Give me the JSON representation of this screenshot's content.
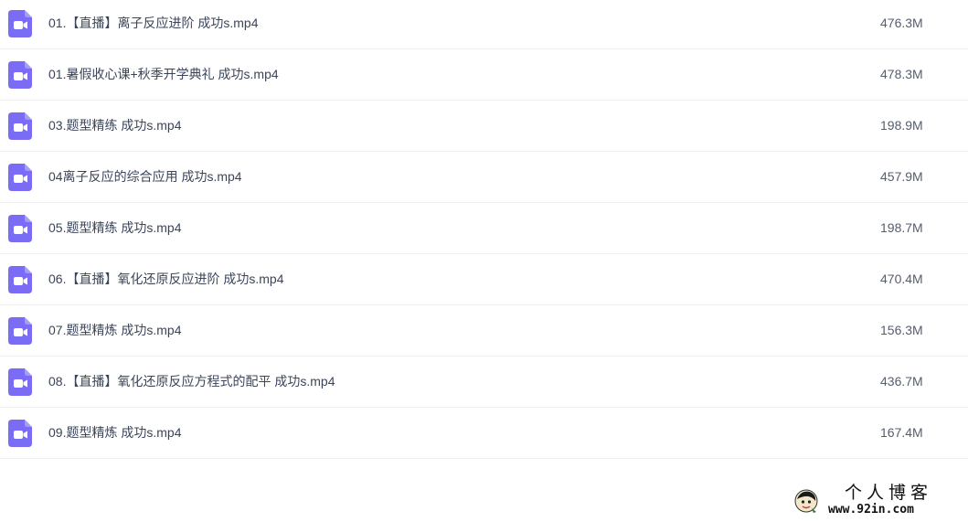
{
  "files": [
    {
      "name": "01.【直播】离子反应进阶 成功s.mp4",
      "size": "476.3M",
      "icon": "video-file-icon"
    },
    {
      "name": "01.暑假收心课+秋季开学典礼 成功s.mp4",
      "size": "478.3M",
      "icon": "video-file-icon"
    },
    {
      "name": "03.题型精练 成功s.mp4",
      "size": "198.9M",
      "icon": "video-file-icon"
    },
    {
      "name": "04离子反应的综合应用 成功s.mp4",
      "size": "457.9M",
      "icon": "video-file-icon"
    },
    {
      "name": "05.题型精练 成功s.mp4",
      "size": "198.7M",
      "icon": "video-file-icon"
    },
    {
      "name": "06.【直播】氧化还原反应进阶 成功s.mp4",
      "size": "470.4M",
      "icon": "video-file-icon"
    },
    {
      "name": "07.题型精炼 成功s.mp4",
      "size": "156.3M",
      "icon": "video-file-icon"
    },
    {
      "name": "08.【直播】氧化还原反应方程式的配平 成功s.mp4",
      "size": "436.7M",
      "icon": "video-file-icon"
    },
    {
      "name": "09.题型精炼 成功s.mp4",
      "size": "167.4M",
      "icon": "video-file-icon"
    }
  ],
  "watermark": {
    "title": "个人博客",
    "url": "www.92in.com"
  },
  "colors": {
    "icon_accent": "#7b6cf6",
    "row_divider": "#eef0f4",
    "text": "#3b4559"
  }
}
